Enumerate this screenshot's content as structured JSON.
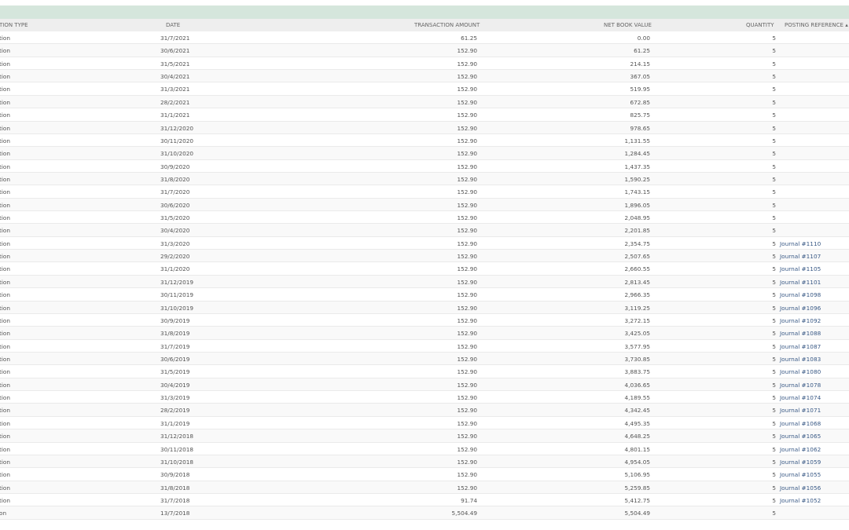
{
  "table": {
    "headers": {
      "type": "TION TYPE",
      "date": "DATE",
      "amount": "TRANSACTION AMOUNT",
      "nbv": "NET BOOK VALUE",
      "quantity": "QUANTITY",
      "posting_ref": "POSTING REFERENCE ▴"
    },
    "rows": [
      {
        "type": "tion",
        "date": "31/7/2021",
        "amount": "61.25",
        "nbv": "0.00",
        "qty": "5",
        "ref": ""
      },
      {
        "type": "tion",
        "date": "30/6/2021",
        "amount": "152.90",
        "nbv": "61.25",
        "qty": "5",
        "ref": ""
      },
      {
        "type": "tion",
        "date": "31/5/2021",
        "amount": "152.90",
        "nbv": "214.15",
        "qty": "5",
        "ref": ""
      },
      {
        "type": "tion",
        "date": "30/4/2021",
        "amount": "152.90",
        "nbv": "367.05",
        "qty": "5",
        "ref": ""
      },
      {
        "type": "tion",
        "date": "31/3/2021",
        "amount": "152.90",
        "nbv": "519.95",
        "qty": "5",
        "ref": ""
      },
      {
        "type": "tion",
        "date": "28/2/2021",
        "amount": "152.90",
        "nbv": "672.85",
        "qty": "5",
        "ref": ""
      },
      {
        "type": "tion",
        "date": "31/1/2021",
        "amount": "152.90",
        "nbv": "825.75",
        "qty": "5",
        "ref": ""
      },
      {
        "type": "tion",
        "date": "31/12/2020",
        "amount": "152.90",
        "nbv": "978.65",
        "qty": "5",
        "ref": ""
      },
      {
        "type": "tion",
        "date": "30/11/2020",
        "amount": "152.90",
        "nbv": "1,131.55",
        "qty": "5",
        "ref": ""
      },
      {
        "type": "tion",
        "date": "31/10/2020",
        "amount": "152.90",
        "nbv": "1,284.45",
        "qty": "5",
        "ref": ""
      },
      {
        "type": "tion",
        "date": "30/9/2020",
        "amount": "152.90",
        "nbv": "1,437.35",
        "qty": "5",
        "ref": ""
      },
      {
        "type": "tion",
        "date": "31/8/2020",
        "amount": "152.90",
        "nbv": "1,590.25",
        "qty": "5",
        "ref": ""
      },
      {
        "type": "tion",
        "date": "31/7/2020",
        "amount": "152.90",
        "nbv": "1,743.15",
        "qty": "5",
        "ref": ""
      },
      {
        "type": "tion",
        "date": "30/6/2020",
        "amount": "152.90",
        "nbv": "1,896.05",
        "qty": "5",
        "ref": ""
      },
      {
        "type": "tion",
        "date": "31/5/2020",
        "amount": "152.90",
        "nbv": "2,048.95",
        "qty": "5",
        "ref": ""
      },
      {
        "type": "tion",
        "date": "30/4/2020",
        "amount": "152.90",
        "nbv": "2,201.85",
        "qty": "5",
        "ref": ""
      },
      {
        "type": "tion",
        "date": "31/3/2020",
        "amount": "152.90",
        "nbv": "2,354.75",
        "qty": "5",
        "ref": "Journal #1110"
      },
      {
        "type": "tion",
        "date": "29/2/2020",
        "amount": "152.90",
        "nbv": "2,507.65",
        "qty": "5",
        "ref": "Journal #1107"
      },
      {
        "type": "tion",
        "date": "31/1/2020",
        "amount": "152.90",
        "nbv": "2,660.55",
        "qty": "5",
        "ref": "Journal #1105"
      },
      {
        "type": "tion",
        "date": "31/12/2019",
        "amount": "152.90",
        "nbv": "2,813.45",
        "qty": "5",
        "ref": "Journal #1101"
      },
      {
        "type": "tion",
        "date": "30/11/2019",
        "amount": "152.90",
        "nbv": "2,966.35",
        "qty": "5",
        "ref": "Journal #1098"
      },
      {
        "type": "tion",
        "date": "31/10/2019",
        "amount": "152.90",
        "nbv": "3,119.25",
        "qty": "5",
        "ref": "Journal #1096"
      },
      {
        "type": "tion",
        "date": "30/9/2019",
        "amount": "152.90",
        "nbv": "3,272.15",
        "qty": "5",
        "ref": "Journal #1092"
      },
      {
        "type": "tion",
        "date": "31/8/2019",
        "amount": "152.90",
        "nbv": "3,425.05",
        "qty": "5",
        "ref": "Journal #1088"
      },
      {
        "type": "tion",
        "date": "31/7/2019",
        "amount": "152.90",
        "nbv": "3,577.95",
        "qty": "5",
        "ref": "Journal #1087"
      },
      {
        "type": "tion",
        "date": "30/6/2019",
        "amount": "152.90",
        "nbv": "3,730.85",
        "qty": "5",
        "ref": "Journal #1083"
      },
      {
        "type": "tion",
        "date": "31/5/2019",
        "amount": "152.90",
        "nbv": "3,883.75",
        "qty": "5",
        "ref": "Journal #1080"
      },
      {
        "type": "tion",
        "date": "30/4/2019",
        "amount": "152.90",
        "nbv": "4,036.65",
        "qty": "5",
        "ref": "Journal #1078"
      },
      {
        "type": "tion",
        "date": "31/3/2019",
        "amount": "152.90",
        "nbv": "4,189.55",
        "qty": "5",
        "ref": "Journal #1074"
      },
      {
        "type": "tion",
        "date": "28/2/2019",
        "amount": "152.90",
        "nbv": "4,342.45",
        "qty": "5",
        "ref": "Journal #1071"
      },
      {
        "type": "tion",
        "date": "31/1/2019",
        "amount": "152.90",
        "nbv": "4,495.35",
        "qty": "5",
        "ref": "Journal #1068"
      },
      {
        "type": "tion",
        "date": "31/12/2018",
        "amount": "152.90",
        "nbv": "4,648.25",
        "qty": "5",
        "ref": "Journal #1065"
      },
      {
        "type": "tion",
        "date": "30/11/2018",
        "amount": "152.90",
        "nbv": "4,801.15",
        "qty": "5",
        "ref": "Journal #1062"
      },
      {
        "type": "tion",
        "date": "31/10/2018",
        "amount": "152.90",
        "nbv": "4,954.05",
        "qty": "5",
        "ref": "Journal #1059"
      },
      {
        "type": "tion",
        "date": "30/9/2018",
        "amount": "152.90",
        "nbv": "5,106.95",
        "qty": "5",
        "ref": "Journal #1055"
      },
      {
        "type": "tion",
        "date": "31/8/2018",
        "amount": "152.90",
        "nbv": "5,259.85",
        "qty": "5",
        "ref": "Journal #1056"
      },
      {
        "type": "tion",
        "date": "31/7/2018",
        "amount": "91.74",
        "nbv": "5,412.75",
        "qty": "5",
        "ref": "Journal #1052"
      },
      {
        "type": "on",
        "date": "13/7/2018",
        "amount": "5,504.49",
        "nbv": "5,504.49",
        "qty": "5",
        "ref": ""
      }
    ]
  }
}
